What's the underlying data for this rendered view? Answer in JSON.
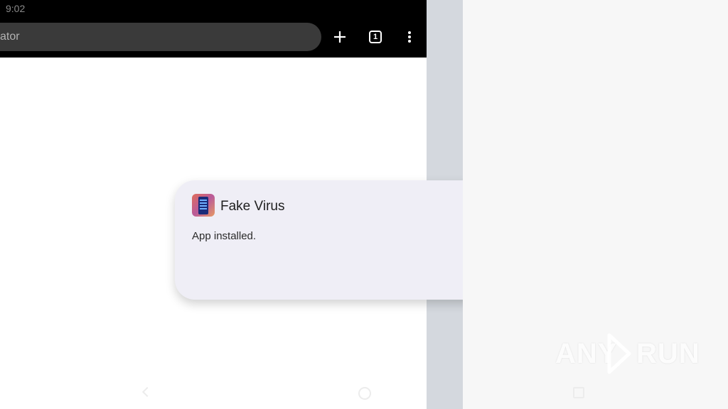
{
  "status_bar": {
    "time": "9:02"
  },
  "browser": {
    "url_text": "ator",
    "new_tab_icon": "plus-icon",
    "tab_count": "1",
    "menu_icon": "more-vert-icon"
  },
  "notification": {
    "app_name": "Fake Virus",
    "message": "App installed.",
    "app_icon": "fake-virus-app-icon"
  },
  "navigation": {
    "back_icon": "back-icon",
    "home_icon": "home-icon",
    "recents_icon": "recents-icon"
  },
  "watermark": {
    "left": "ANY",
    "right": "RUN"
  },
  "colors": {
    "toolbar": "#000000",
    "url_bar": "#3a3a3a",
    "notification_bg": "#efeef6",
    "divider_strip": "#d4d8de",
    "right_pane": "#f7f7f7"
  }
}
